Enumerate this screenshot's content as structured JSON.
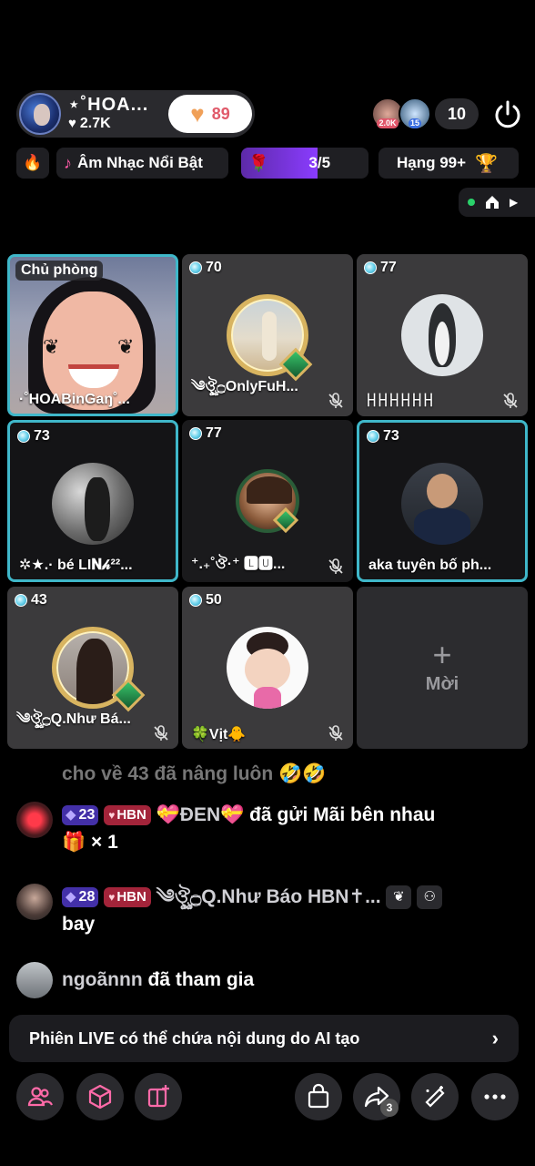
{
  "header": {
    "host_name": "⋆˚HOA...",
    "host_likes": "2.7K",
    "follow_count": "89",
    "viewer_badges": [
      "2.0K",
      "15"
    ],
    "viewer_count": "10"
  },
  "chips": {
    "music_label": "Âm Nhạc Nổi Bật",
    "progress_label": "3/5",
    "progress_value": 0.6,
    "rank_label": "Hạng 99+"
  },
  "seats": [
    {
      "label": "Chủ phòng",
      "name": "·˚HOABinGaŋ˚...",
      "host": true
    },
    {
      "score": "70",
      "name": "༄ঔৣ۝OnlyFuH...",
      "muted": true
    },
    {
      "score": "77",
      "name": "ꀿꀿꀿꀿꀿꀿ",
      "muted": true
    },
    {
      "score": "73",
      "name": "✲★.· bé LI𝐍𝒽²²...",
      "muted": false
    },
    {
      "score": "77",
      "name": "⁺.₊˚ঔ·⁺ 🅻🆄...",
      "muted": true
    },
    {
      "score": "73",
      "name": "aka tuyên bố ph...",
      "muted": false
    },
    {
      "score": "43",
      "name": "༄ঔৣ۝Q.Như Bá...",
      "muted": true
    },
    {
      "score": "50",
      "name": "🍀Vịt🐥",
      "muted": true
    }
  ],
  "invite": {
    "label": "Mời"
  },
  "chat": {
    "faded_line": "cho về 43 đã nâng luôn 🤣🤣",
    "msg1": {
      "level": "23",
      "fan_badge": "HBN",
      "user": "💝ĐEN💝",
      "text": "đã gửi Mãi bên nhau",
      "gift_count": "× 1"
    },
    "msg2": {
      "level": "28",
      "fan_badge": "HBN",
      "user": "༄ঔৣ۝Q.Như Báo HBN✝...",
      "text": "bay"
    },
    "msg3": {
      "user": "ngoãnnn",
      "text": "đã tham gia"
    }
  },
  "ai_notice": "Phiên LIVE có thể chứa nội dung do AI tạo",
  "bottom": {
    "share_count": "3"
  },
  "colors": {
    "accent_teal": "#3fb7c9",
    "progress_purple": "#8a3cff",
    "fan_red": "#a3243a",
    "level_blue": "#4330a8"
  }
}
